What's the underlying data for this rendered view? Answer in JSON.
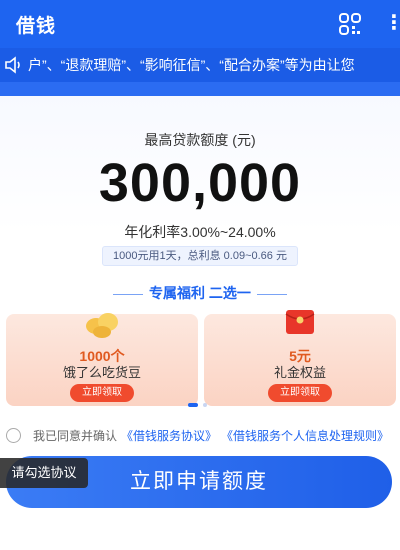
{
  "header": {
    "title": "借钱",
    "scan_icon": "scan-icon",
    "more_icon": "more-icon"
  },
  "notice": {
    "text": "户”、“退款理赔”、“影响征信”、“配合办案”等为由让您",
    "icon": "speaker-icon"
  },
  "loan": {
    "amount_label": "最高贷款额度 (元)",
    "amount": "300,000",
    "rate": "年化利率3.00%~24.00%",
    "interest_note": "1000元用1天，总利息 0.09~0.66 元"
  },
  "welfare": {
    "title": "专属福利 二选一",
    "items": [
      {
        "title": "1000个",
        "subtitle": "饿了么吃货豆",
        "button": "立即领取",
        "icon": "beans-icon"
      },
      {
        "title": "5元",
        "subtitle": "礼金权益",
        "button": "立即领取",
        "icon": "red-envelope-icon"
      }
    ]
  },
  "agreement": {
    "prefix": "我已同意并确认",
    "link1": "《借钱服务协议》",
    "link2": "《借钱服务个人信息处理规则》"
  },
  "apply_button": "立即申请额度",
  "tooltip": "请勾选协议",
  "colors": {
    "brand": "#1e64f0",
    "accent": "#f04b2e"
  }
}
